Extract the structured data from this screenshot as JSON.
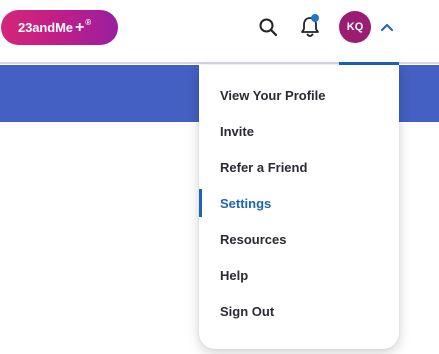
{
  "header": {
    "brand": {
      "name": "23andMe",
      "plus": "+",
      "mark": "®"
    },
    "search_icon": "search-icon",
    "notifications": {
      "icon": "bell-icon",
      "has_unread": true
    },
    "avatar": {
      "initials": "KQ",
      "color": "#9a1d72"
    },
    "menu_toggle_icon": "chevron-up-icon"
  },
  "colors": {
    "brand_gradient": [
      "#d3267a",
      "#9a1fa0"
    ],
    "accent": "#1e64b4",
    "band": "#4360c2",
    "notification_dot": "#1e78c8"
  },
  "menu": {
    "items": [
      {
        "label": "View Your Profile",
        "active": false
      },
      {
        "label": "Invite",
        "active": false
      },
      {
        "label": "Refer a Friend",
        "active": false
      },
      {
        "label": "Settings",
        "active": true
      },
      {
        "label": "Resources",
        "active": false
      },
      {
        "label": "Help",
        "active": false
      },
      {
        "label": "Sign Out",
        "active": false
      }
    ]
  }
}
